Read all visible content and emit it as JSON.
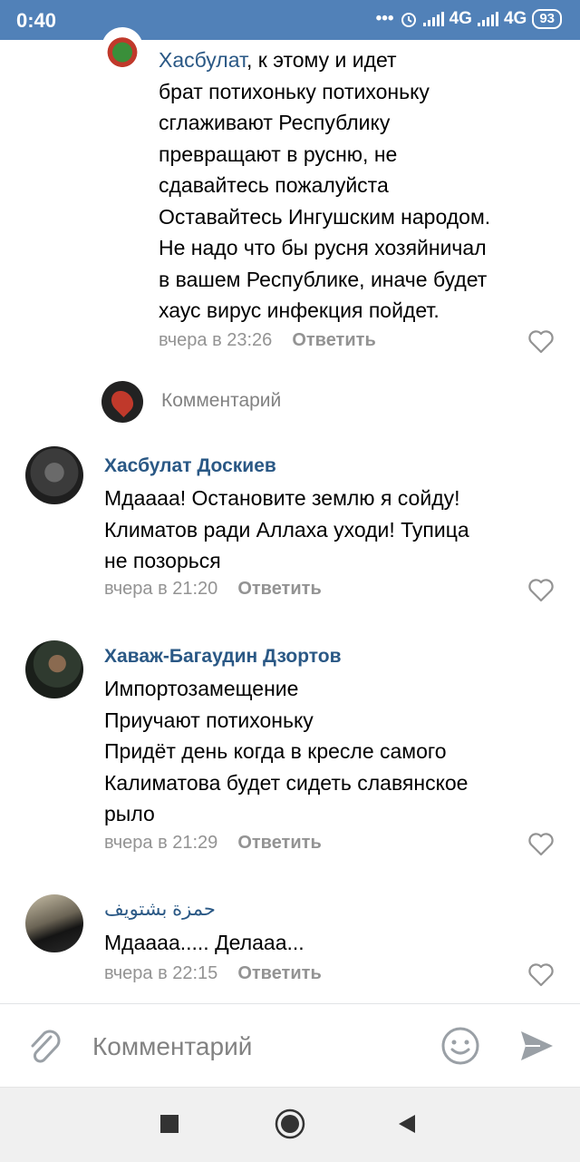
{
  "status_bar": {
    "time": "0:40",
    "network_1": "4G",
    "network_2": "4G",
    "battery": "93"
  },
  "top_reply": {
    "author": "Хасбулат",
    "text": ", к этому и идет\nбрат потихоньку потихоньку\nсглаживают Республику\nпревращают в русню,  не\nсдавайтесь пожалуйста\nОставайтесь Ингушским народом.\nНе надо что бы русня хозяйничал\nв вашем Республике,  иначе будет\nхаус вирус инфекция пойдет.",
    "time": "вчера в 23:26",
    "reply_label": "Ответить"
  },
  "reply_input": {
    "placeholder": "Комментарий"
  },
  "comments": [
    {
      "author": "Хасбулат Доскиев",
      "text": "Мдаааа! Остановите землю я сойду!\nКлиматов ради Аллаха уходи! Тупица\nне позорься",
      "time": "вчера в 21:20",
      "reply_label": "Ответить"
    },
    {
      "author": "Хаваж-Багаудин Дзортов",
      "text": "Импортозамещение\nПриучают потихоньку\nПридёт день когда в кресле самого\nКалиматова будет сидеть славянское\nрыло",
      "time": "вчера в 21:29",
      "reply_label": "Ответить"
    },
    {
      "author": "حمزة بشتويف",
      "text": "Мдаааа..... Делааа...",
      "time": "вчера в 22:15",
      "reply_label": "Ответить"
    }
  ],
  "composer": {
    "placeholder": "Комментарий"
  },
  "icons": {
    "attach": "paperclip-icon",
    "emoji": "smile-icon",
    "send": "send-icon",
    "like": "heart-icon"
  },
  "colors": {
    "status_bar": "#5181b8",
    "author_link": "#2a5885",
    "meta_text": "#939393"
  }
}
